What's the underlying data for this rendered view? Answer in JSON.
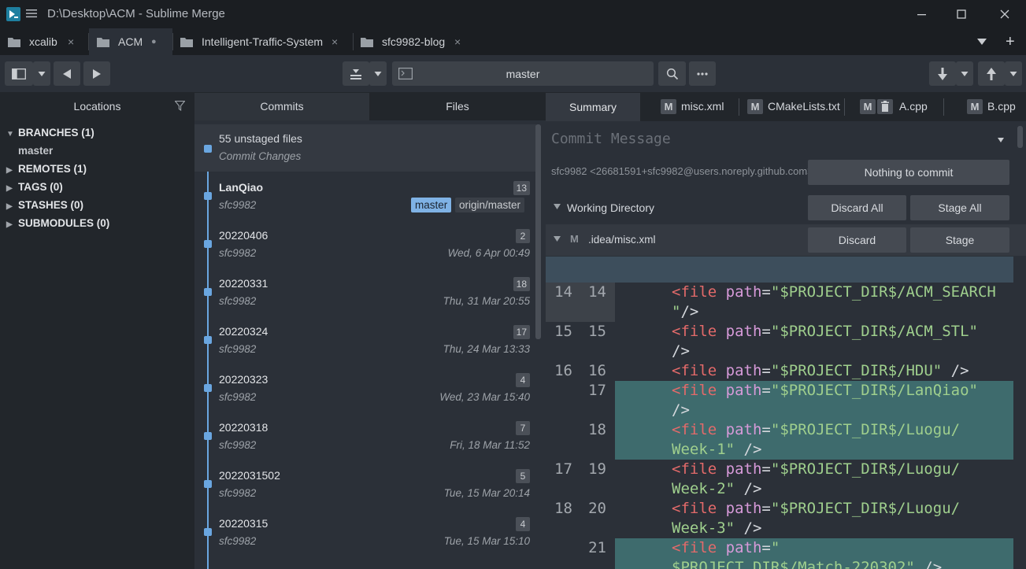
{
  "window": {
    "title": "D:\\Desktop\\ACM - Sublime Merge"
  },
  "tabs": [
    {
      "label": "xcalib",
      "close": "×"
    },
    {
      "label": "ACM",
      "close": "●"
    },
    {
      "label": "Intelligent-Traffic-System",
      "close": "×"
    },
    {
      "label": "sfc9982-blog",
      "close": "×"
    }
  ],
  "tabbar": {
    "add": "+"
  },
  "toolbar": {
    "branch": "master"
  },
  "locations": {
    "title": "Locations",
    "branches": "BRANCHES (1)",
    "branch_items": [
      "master"
    ],
    "remotes": "REMOTES (1)",
    "tags": "TAGS (0)",
    "stashes": "STASHES (0)",
    "submodules": "SUBMODULES (0)"
  },
  "commits_panel": {
    "tab_commits": "Commits",
    "tab_files": "Files",
    "unstaged": {
      "title": "55 unstaged files",
      "subtitle": "Commit Changes"
    },
    "commits": [
      {
        "message": "LanQiao",
        "author": "sfc9982",
        "count": "13",
        "date": "",
        "branch": "master",
        "remote": "origin/master"
      },
      {
        "message": "20220406",
        "author": "sfc9982",
        "count": "2",
        "date": "Wed, 6 Apr 00:49"
      },
      {
        "message": "20220331",
        "author": "sfc9982",
        "count": "18",
        "date": "Thu, 31 Mar 20:55"
      },
      {
        "message": "20220324",
        "author": "sfc9982",
        "count": "17",
        "date": "Thu, 24 Mar 13:33"
      },
      {
        "message": "20220323",
        "author": "sfc9982",
        "count": "4",
        "date": "Wed, 23 Mar 15:40"
      },
      {
        "message": "20220318",
        "author": "sfc9982",
        "count": "7",
        "date": "Fri, 18 Mar 11:52"
      },
      {
        "message": "2022031502",
        "author": "sfc9982",
        "count": "5",
        "date": "Tue, 15 Mar 20:14"
      },
      {
        "message": "20220315",
        "author": "sfc9982",
        "count": "4",
        "date": "Tue, 15 Mar 15:10"
      }
    ]
  },
  "detail": {
    "tab_summary": "Summary",
    "file_tabs": [
      {
        "status": "M",
        "name": "misc.xml"
      },
      {
        "status": "M",
        "name": "CMakeLists.txt"
      },
      {
        "status": "M",
        "name": "A.cpp"
      },
      {
        "status": "M",
        "name": "B.cpp"
      }
    ],
    "commit_message_placeholder": "Commit Message",
    "committer": "sfc9982 <26681591+sfc9982@users.noreply.github.com>",
    "nothing_to_commit": "Nothing to commit",
    "working_directory": "Working Directory",
    "discard_all": "Discard All",
    "stage_all": "Stage All",
    "file": {
      "status": "M",
      "name": ".idea/misc.xml",
      "discard": "Discard",
      "stage": "Stage"
    },
    "diff": [
      {
        "old": "14",
        "new": "14",
        "lines": [
          [
            "<",
            "file",
            " path",
            "=",
            "\"$PROJECT_DIR$/ACM_SEARCH"
          ],
          [
            "\"",
            "/>"
          ]
        ],
        "type": "ctx"
      },
      {
        "old": "15",
        "new": "15",
        "lines": [
          [
            "<",
            "file",
            " path",
            "=",
            "\"$PROJECT_DIR$/ACM_STL\""
          ],
          [
            "",
            "/>"
          ]
        ],
        "type": "ctx"
      },
      {
        "old": "16",
        "new": "16",
        "lines": [
          [
            "<",
            "file",
            " path",
            "=",
            "\"$PROJECT_DIR$/HDU\" ",
            "/>"
          ]
        ],
        "type": "ctx"
      },
      {
        "old": "",
        "new": "17",
        "lines": [
          [
            "<",
            "file",
            " path",
            "=",
            "\"$PROJECT_DIR$/LanQiao\""
          ],
          [
            "",
            "/>"
          ]
        ],
        "type": "add"
      },
      {
        "old": "",
        "new": "18",
        "lines": [
          [
            "<",
            "file",
            " path",
            "=",
            "\"$PROJECT_DIR$/Luogu/"
          ],
          [
            "Week-1\" ",
            "/>"
          ]
        ],
        "type": "add"
      },
      {
        "old": "17",
        "new": "19",
        "lines": [
          [
            "<",
            "file",
            " path",
            "=",
            "\"$PROJECT_DIR$/Luogu/"
          ],
          [
            "Week-2\" ",
            "/>"
          ]
        ],
        "type": "ctx"
      },
      {
        "old": "18",
        "new": "20",
        "lines": [
          [
            "<",
            "file",
            " path",
            "=",
            "\"$PROJECT_DIR$/Luogu/"
          ],
          [
            "Week-3\" ",
            "/>"
          ]
        ],
        "type": "ctx"
      },
      {
        "old": "",
        "new": "21",
        "lines": [
          [
            "<",
            "file",
            " path",
            "=",
            "\""
          ],
          [
            "$PROJECT_DIR$/Match-220302\" ",
            "/>"
          ]
        ],
        "type": "add"
      }
    ]
  }
}
